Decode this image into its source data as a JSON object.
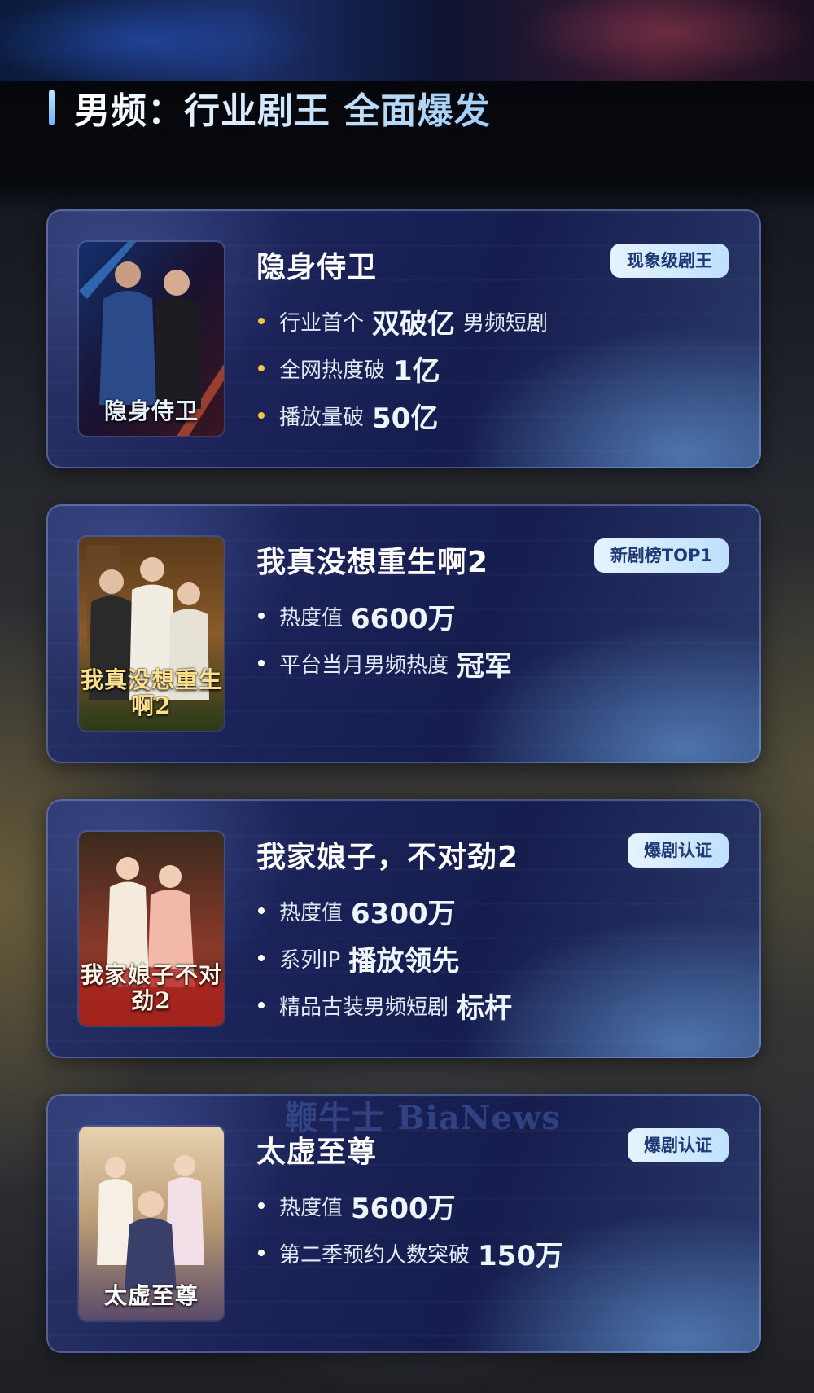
{
  "header": {
    "title": "男频：行业剧王 全面爆发"
  },
  "colors": {
    "accent_light": "#bfe0ff",
    "gold_dot": "#f5c542",
    "white_dot": "#ffffff"
  },
  "cards": [
    {
      "title": "隐身侍卫",
      "badge": "现象级剧王",
      "poster_title": "隐身侍卫",
      "bullets": [
        {
          "pre": "行业首个",
          "highlight": "双破亿",
          "post": "男频短剧",
          "dot": "gold"
        },
        {
          "pre": "全网热度破",
          "highlight": "1亿",
          "post": "",
          "dot": "gold"
        },
        {
          "pre": "播放量破",
          "highlight": "50亿",
          "post": "",
          "dot": "gold"
        }
      ]
    },
    {
      "title": "我真没想重生啊2",
      "badge": "新剧榜TOP1",
      "poster_title": "我真没想重生啊2",
      "bullets": [
        {
          "pre": "热度值",
          "highlight": "6600万",
          "post": "",
          "dot": "white"
        },
        {
          "pre": "平台当月男频热度",
          "highlight": "冠军",
          "post": "",
          "dot": "white"
        }
      ]
    },
    {
      "title": "我家娘子，不对劲2",
      "badge": "爆剧认证",
      "poster_title": "我家娘子不对劲2",
      "bullets": [
        {
          "pre": "热度值",
          "highlight": "6300万",
          "post": "",
          "dot": "white"
        },
        {
          "pre": "系列IP",
          "highlight": "播放领先",
          "post": "",
          "dot": "white"
        },
        {
          "pre": "精品古装男频短剧",
          "highlight": "标杆",
          "post": "",
          "dot": "white"
        }
      ]
    },
    {
      "title": "太虚至尊",
      "badge": "爆剧认证",
      "poster_title": "太虚至尊",
      "bullets": [
        {
          "pre": "热度值",
          "highlight": "5600万",
          "post": "",
          "dot": "white"
        },
        {
          "pre": "第二季预约人数突破",
          "highlight": "150万",
          "post": "",
          "dot": "white"
        }
      ]
    }
  ],
  "watermark": "鞭牛士 BiaNews"
}
